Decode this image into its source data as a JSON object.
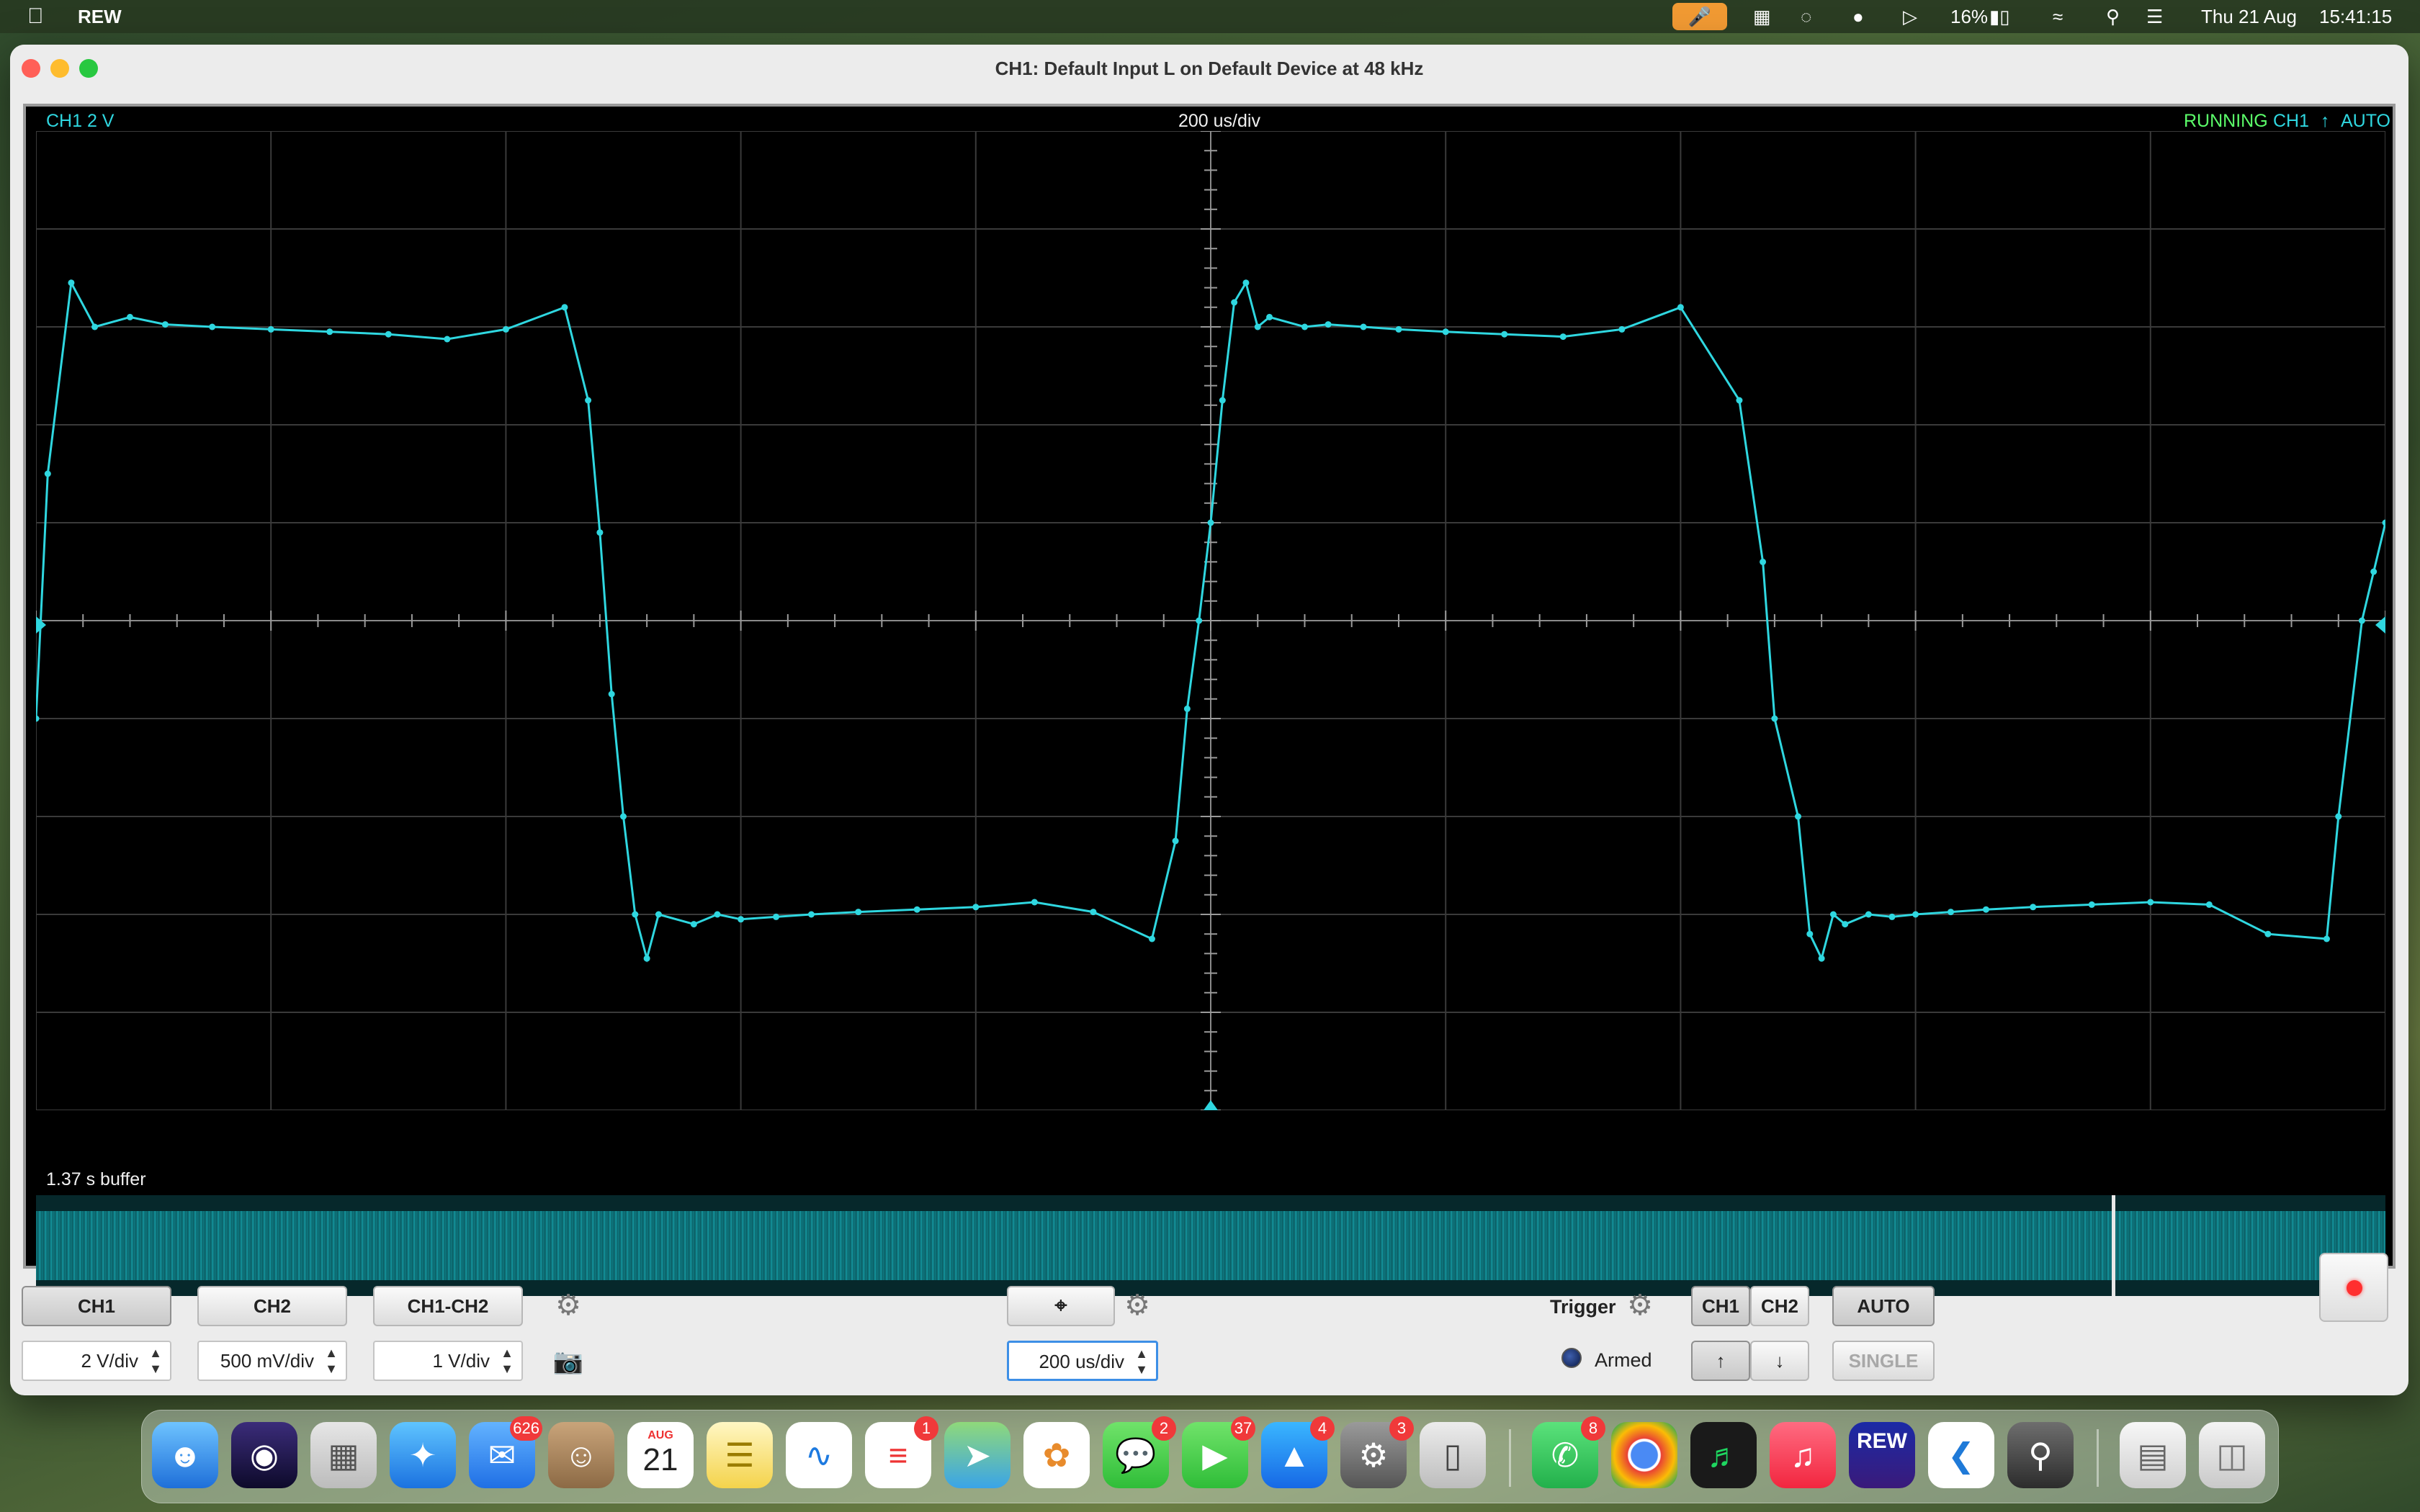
{
  "menubar": {
    "app_name": "REW",
    "battery": "16%",
    "date": "Thu 21 Aug",
    "time": "15:41:15"
  },
  "window": {
    "title": "CH1: Default Input L on Default Device at 48 kHz"
  },
  "scope": {
    "ch_scale": "CH1 2 V",
    "timebase": "200 us/div",
    "status_running": "RUNNING",
    "status_channel": "CH1",
    "status_mode": "AUTO",
    "buffer_label": "1.37 s buffer"
  },
  "controls": {
    "ch1_label": "CH1",
    "ch2_label": "CH2",
    "diff_label": "CH1-CH2",
    "ch1_scale": "2 V/div",
    "ch2_scale": "500 mV/div",
    "diff_scale": "1 V/div",
    "timebase_value": "200 us/div",
    "trigger_label": "Trigger",
    "trig_ch1": "CH1",
    "trig_ch2": "CH2",
    "auto_label": "AUTO",
    "armed_label": "Armed",
    "single_label": "SINGLE"
  },
  "dock": {
    "mail_badge": "626",
    "calendar_month": "AUG",
    "calendar_day": "21",
    "reminders_badge": "1",
    "messages_badge": "2",
    "facetime_badge": "37",
    "appstore_badge": "4",
    "settings_badge": "3",
    "whatsapp_badge": "8",
    "rew_label": "REW"
  },
  "colors": {
    "trace": "#2fd7e0",
    "grid": "#3a3a3a",
    "running": "#5cff6a"
  },
  "chart_data": {
    "type": "line",
    "title": "",
    "xlabel": "",
    "ylabel": "",
    "x_divisions": 10,
    "y_divisions": 10,
    "y_units_per_div": 2,
    "x_units_per_div_us": 200,
    "series": [
      {
        "x_us": [
          -1000,
          -990,
          -970,
          -950,
          -920,
          -890,
          -850,
          -800,
          -750,
          -700,
          -650,
          -600,
          -550,
          -530,
          -520,
          -510,
          -500,
          -490,
          -480,
          -470,
          -440,
          -420,
          -400,
          -370,
          -340,
          -300,
          -250,
          -200,
          -150,
          -100,
          -50,
          -30,
          -20,
          -10,
          0,
          10,
          20,
          30,
          40,
          50,
          80,
          100,
          130,
          160,
          200,
          250,
          300,
          350,
          400,
          450,
          470,
          480,
          500,
          510,
          520,
          530,
          540,
          560,
          580,
          600,
          630,
          660,
          700,
          750,
          800,
          850,
          900,
          950,
          960,
          980,
          990,
          1000
        ],
        "y_volts": [
          -2,
          3,
          6.9,
          6.0,
          6.2,
          6.05,
          6.0,
          5.95,
          5.9,
          5.85,
          5.75,
          5.95,
          6.4,
          4.5,
          1.8,
          -1.5,
          -4.0,
          -6.0,
          -6.9,
          -6.0,
          -6.2,
          -6.0,
          -6.1,
          -6.05,
          -6.0,
          -5.95,
          -5.9,
          -5.85,
          -5.75,
          -5.95,
          -6.5,
          -4.5,
          -1.8,
          0,
          2.0,
          4.5,
          6.5,
          6.9,
          6.0,
          6.2,
          6.0,
          6.05,
          6.0,
          5.95,
          5.9,
          5.85,
          5.8,
          5.95,
          6.4,
          4.5,
          1.2,
          -2.0,
          -4.0,
          -6.4,
          -6.9,
          -6.0,
          -6.2,
          -6.0,
          -6.05,
          -6.0,
          -5.95,
          -5.9,
          -5.85,
          -5.8,
          -5.75,
          -5.8,
          -6.4,
          -6.5,
          -4.0,
          0,
          1.0,
          2.0
        ]
      }
    ]
  }
}
